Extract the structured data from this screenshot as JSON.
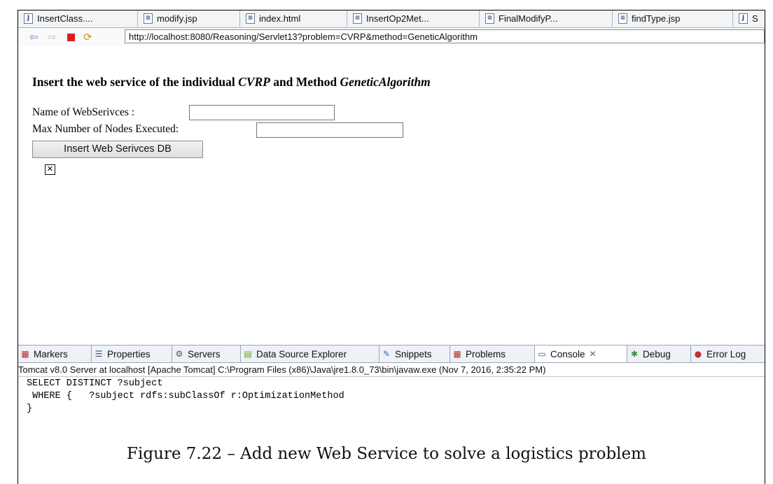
{
  "tabs": [
    {
      "label": "InsertClass....",
      "icon": "java-file-icon",
      "glyph": "J"
    },
    {
      "label": "modify.jsp",
      "icon": "jsp-file-icon",
      "glyph": "≡"
    },
    {
      "label": "index.html",
      "icon": "html-file-icon",
      "glyph": "≡"
    },
    {
      "label": "InsertOp2Met...",
      "icon": "java-file-icon",
      "glyph": "≡"
    },
    {
      "label": "FinalModifyP...",
      "icon": "jsp-file-icon",
      "glyph": "≡"
    },
    {
      "label": "findType.jsp",
      "icon": "jsp-file-icon",
      "glyph": "≡"
    },
    {
      "label": "S",
      "icon": "java-file-icon",
      "glyph": "J"
    }
  ],
  "address_bar": {
    "url": "http://localhost:8080/Reasoning/Servlet13?problem=CVRP&method=GeneticAlgorithm"
  },
  "page": {
    "heading_pre": "Insert the web service of the individual ",
    "heading_problem": "CVRP",
    "heading_mid": " and Method ",
    "heading_method": "GeneticAlgorithm",
    "name_label": "Name of WebSerivces :",
    "name_value": "",
    "max_label": "Max Number of Nodes Executed:",
    "max_value": "",
    "submit_label": "Insert Web Serivces DB"
  },
  "views": [
    {
      "label": "Markers",
      "icon": "markers-icon",
      "glyph": "▦",
      "color": "#b03030"
    },
    {
      "label": "Properties",
      "icon": "properties-icon",
      "glyph": "☰",
      "color": "#3a5a8a"
    },
    {
      "label": "Servers",
      "icon": "servers-icon",
      "glyph": "⚙",
      "color": "#555555"
    },
    {
      "label": "Data Source Explorer",
      "icon": "data-source-icon",
      "glyph": "▤",
      "color": "#6a9a2a"
    },
    {
      "label": "Snippets",
      "icon": "snippets-icon",
      "glyph": "✎",
      "color": "#3a6aa0"
    },
    {
      "label": "Problems",
      "icon": "problems-icon",
      "glyph": "▦",
      "color": "#b03030"
    },
    {
      "label": "Console",
      "icon": "console-icon",
      "glyph": "▭",
      "color": "#2a5aa0",
      "active": true
    },
    {
      "label": "Debug",
      "icon": "debug-icon",
      "glyph": "✱",
      "color": "#3a8a3a"
    },
    {
      "label": "Error Log",
      "icon": "error-log-icon",
      "glyph": "●",
      "color": "#c03030"
    }
  ],
  "console": {
    "header": "Tomcat v8.0 Server at localhost [Apache Tomcat] C:\\Program Files (x86)\\Java\\jre1.8.0_73\\bin\\javaw.exe (Nov 7, 2016, 2:35:22 PM)",
    "lines": [
      "SELECT DISTINCT ?subject",
      " WHERE {   ?subject rdfs:subClassOf r:OptimizationMethod",
      "}"
    ]
  },
  "caption": "Figure 7.22 – Add new Web Service to solve a logistics problem"
}
